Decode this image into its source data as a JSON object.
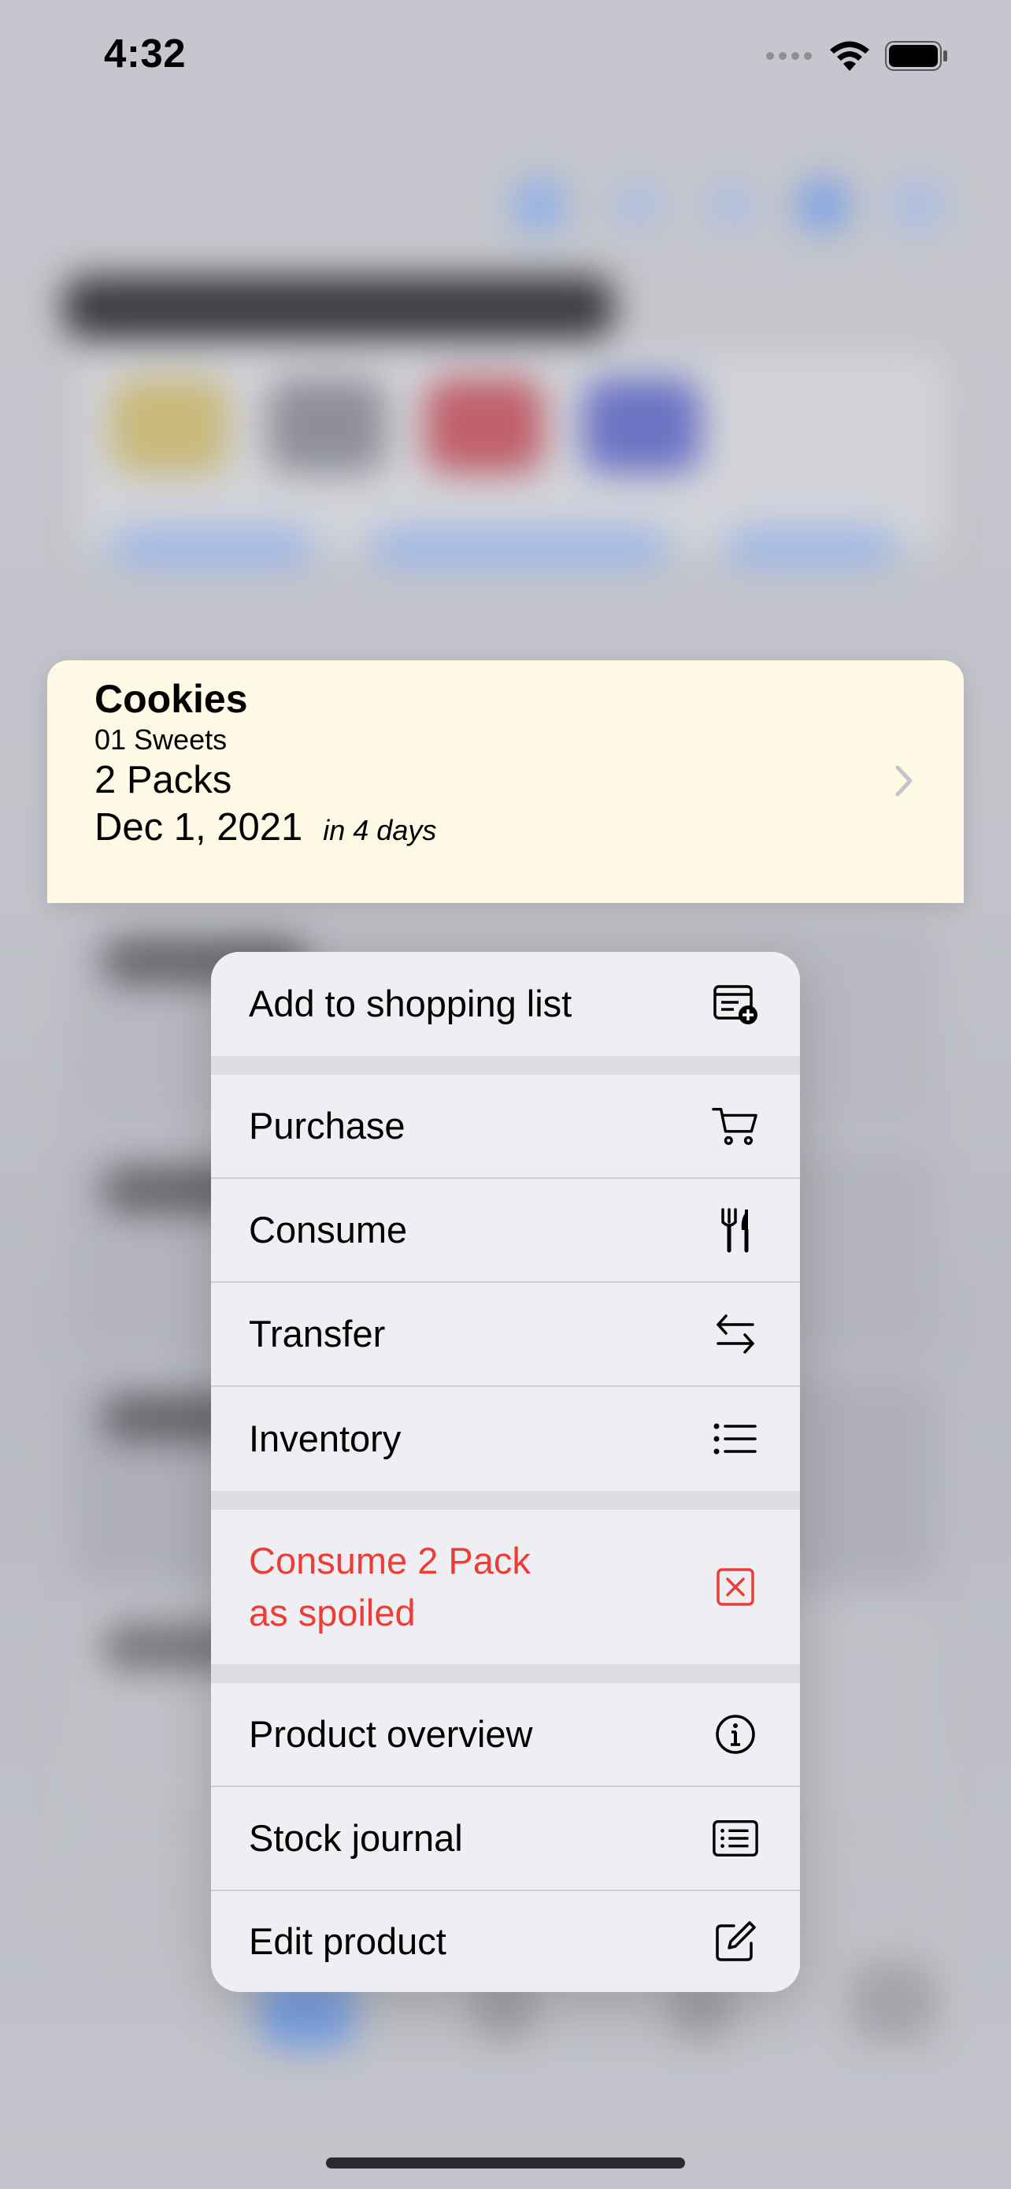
{
  "status_bar": {
    "time": "4:32",
    "icons": [
      "cellular-dots-icon",
      "wifi-icon",
      "battery-icon"
    ]
  },
  "card": {
    "title": "Cookies",
    "location": "01 Sweets",
    "amount": "2 Packs",
    "date": "Dec 1, 2021",
    "due_relative": "in 4 days",
    "background_color": "#fef9e5"
  },
  "menu": {
    "items": [
      {
        "label": "Add to shopping list",
        "icon": "add-to-list-icon"
      },
      {
        "label": "Purchase",
        "icon": "cart-icon"
      },
      {
        "label": "Consume",
        "icon": "fork-knife-icon"
      },
      {
        "label": "Transfer",
        "icon": "transfer-arrows-icon"
      },
      {
        "label": "Inventory",
        "icon": "list-icon"
      },
      {
        "label_line1": "Consume 2 Pack",
        "label_line2": "as spoiled",
        "icon": "xmark-square-icon",
        "color": "#ea3e36"
      },
      {
        "label": "Product overview",
        "icon": "info-circle-icon"
      },
      {
        "label": "Stock journal",
        "icon": "journal-icon"
      },
      {
        "label": "Edit product",
        "icon": "edit-square-icon"
      }
    ]
  },
  "colors": {
    "destructive": "#ea3e36",
    "menu_background": "#efeff3"
  }
}
